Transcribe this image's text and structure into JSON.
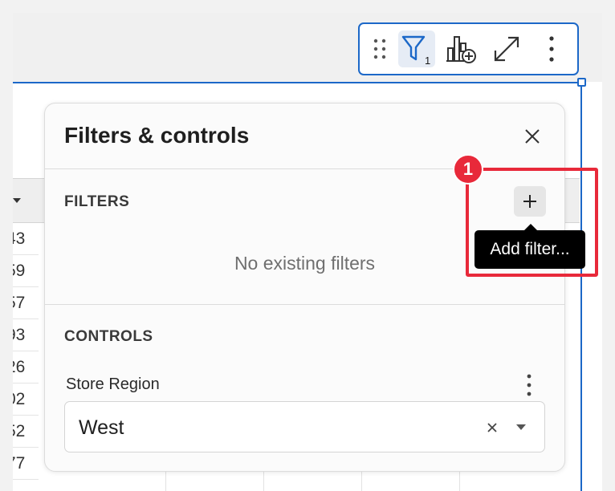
{
  "toolbar": {
    "filter_count": "1",
    "icons": [
      "drag-handle-icon",
      "filter-funnel-icon",
      "add-chart-icon",
      "expand-icon",
      "more-vertical-icon"
    ]
  },
  "table": {
    "visible_cells": [
      "43",
      "59",
      "57",
      "93",
      "26",
      "02",
      "52",
      "77"
    ]
  },
  "panel": {
    "title": "Filters & controls",
    "filters_label": "FILTERS",
    "empty_filters": "No existing filters",
    "controls_label": "CONTROLS",
    "control": {
      "label": "Store Region",
      "selected_value": "West"
    }
  },
  "tooltip": {
    "text": "Add filter..."
  },
  "callout": {
    "number": "1"
  },
  "colors": {
    "accent_blue": "#1c68c8",
    "callout_red": "#e8293a",
    "tooltip_bg": "#000000"
  }
}
